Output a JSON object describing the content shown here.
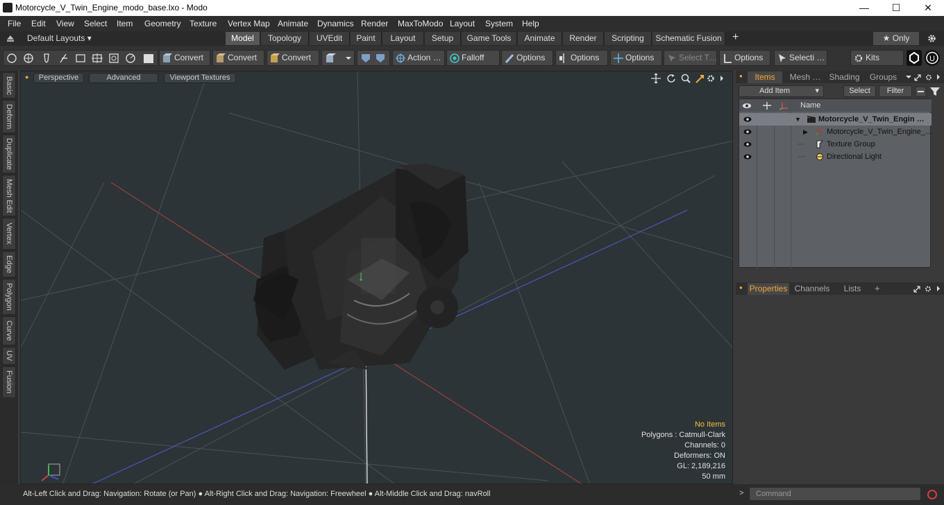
{
  "window": {
    "title": "Motorcycle_V_Twin_Engine_modo_base.lxo - Modo",
    "minimize": "—",
    "maximize": "☐",
    "close": "✕"
  },
  "menu": [
    "File",
    "Edit",
    "View",
    "Select",
    "Item",
    "Geometry",
    "Texture",
    "Vertex Map",
    "Animate",
    "Dynamics",
    "Render",
    "MaxToModo",
    "Layout",
    "System",
    "Help"
  ],
  "layout_selector": "Default Layouts ▾",
  "tabs": [
    "Model",
    "Topology",
    "UVEdit",
    "Paint",
    "Layout",
    "Setup",
    "Game Tools",
    "Animate",
    "Render",
    "Scripting",
    "Schematic Fusion"
  ],
  "tabs_plus": "+",
  "only_label": "★  Only",
  "toolbar": {
    "convert1": "Convert",
    "convert2": "Convert",
    "convert3": "Convert",
    "action": "Action  …",
    "falloff": "Falloff",
    "options1": "Options",
    "options2": "Options",
    "options3": "Options",
    "select_t": "Select T…",
    "options4": "Options",
    "selecti": "Selecti …",
    "kits": "Kits"
  },
  "left_tabs": [
    "Basic",
    "Deform",
    "Duplicate",
    "Mesh Edit",
    "Vertex",
    "Edge",
    "Polygon",
    "Curve",
    "UV",
    "Fusion"
  ],
  "viewport": {
    "perspective": "Perspective",
    "advanced": "Advanced",
    "textures": "Viewport Textures",
    "info": {
      "items": "No Items",
      "polygons": "Polygons : Catmull-Clark",
      "channels": "Channels: 0",
      "deformers": "Deformers: ON",
      "gl": "GL: 2,189,216",
      "mm": "50 mm"
    }
  },
  "items_panel": {
    "tabs": [
      "Items",
      "Mesh …",
      "Shading",
      "Groups"
    ],
    "add_item": "Add Item",
    "select": "Select",
    "filter": "Filter",
    "name_header": "Name",
    "rows": [
      {
        "label": "Motorcycle_V_Twin_Engin …"
      },
      {
        "label": "Motorcycle_V_Twin_Engine_…"
      },
      {
        "label": "Texture Group"
      },
      {
        "label": "Directional Light"
      }
    ]
  },
  "props_panel": {
    "tabs": [
      "Properties",
      "Channels",
      "Lists"
    ],
    "plus": "+"
  },
  "status": "Alt-Left Click and Drag: Navigation: Rotate (or Pan) ● Alt-Right Click and Drag: Navigation: Freewheel ● Alt-Middle Click and Drag: navRoll",
  "command_placeholder": "Command",
  "colors": {
    "accent": "#f2a83a",
    "x_axis": "#c0392b",
    "z_axis": "#3b54c8"
  }
}
